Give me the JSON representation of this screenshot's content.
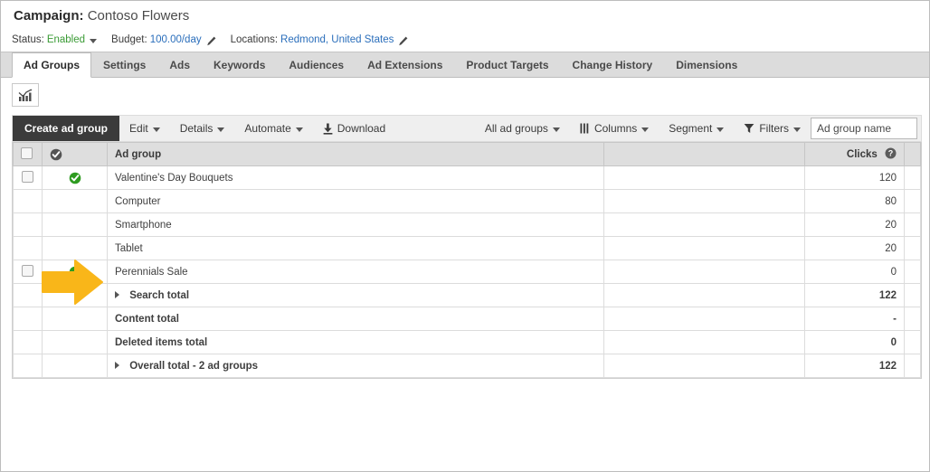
{
  "campaign": {
    "label": "Campaign:",
    "name": "Contoso Flowers"
  },
  "meta": {
    "status_key": "Status:",
    "status_value": "Enabled",
    "budget_key": "Budget:",
    "budget_value": "100.00/day",
    "locations_key": "Locations:",
    "locations_value": "Redmond, United States"
  },
  "tabs": [
    {
      "label": "Ad Groups",
      "active": true
    },
    {
      "label": "Settings",
      "active": false
    },
    {
      "label": "Ads",
      "active": false
    },
    {
      "label": "Keywords",
      "active": false
    },
    {
      "label": "Audiences",
      "active": false
    },
    {
      "label": "Ad Extensions",
      "active": false
    },
    {
      "label": "Product Targets",
      "active": false
    },
    {
      "label": "Change History",
      "active": false
    },
    {
      "label": "Dimensions",
      "active": false
    }
  ],
  "chart_toggle": {
    "icon": "bar-chart-icon"
  },
  "toolbar": {
    "create_label": "Create ad group",
    "edit_label": "Edit",
    "details_label": "Details",
    "automate_label": "Automate",
    "download_label": "Download",
    "download_icon": "download-icon",
    "all_ad_groups_label": "All ad groups",
    "columns_label": "Columns",
    "columns_icon": "columns-icon",
    "segment_label": "Segment",
    "filters_label": "Filters",
    "filters_icon": "funnel-icon",
    "search_placeholder": "Ad group name",
    "search_value": ""
  },
  "table": {
    "headers": {
      "checkbox": "",
      "status": "status-check-icon",
      "name": "Ad group",
      "mid": "",
      "clicks": "Clicks",
      "clicks_help_icon": "help-icon"
    },
    "rows": [
      {
        "type": "adgroup",
        "checkbox": true,
        "status": "enabled",
        "name": "Valentine's Day Bouquets",
        "indent": 0,
        "link": true,
        "clicks": "120"
      },
      {
        "type": "segment",
        "checkbox": false,
        "status": "none",
        "name": "Computer",
        "indent": 1,
        "link": false,
        "clicks": "80"
      },
      {
        "type": "segment",
        "checkbox": false,
        "status": "none",
        "name": "Smartphone",
        "indent": 1,
        "link": false,
        "clicks": "20"
      },
      {
        "type": "segment",
        "checkbox": false,
        "status": "none",
        "name": "Tablet",
        "indent": 1,
        "link": false,
        "clicks": "20"
      },
      {
        "type": "adgroup",
        "checkbox": true,
        "status": "enabled",
        "name": "Perennials Sale",
        "indent": 0,
        "link": true,
        "clicks": "0"
      },
      {
        "type": "total",
        "checkbox": false,
        "status": "none",
        "name": "Search total",
        "indent": 0,
        "link": false,
        "expander": true,
        "clicks": "122"
      },
      {
        "type": "total",
        "checkbox": false,
        "status": "none",
        "name": "Content total",
        "indent": 0,
        "link": false,
        "expander": false,
        "clicks": "-"
      },
      {
        "type": "total",
        "checkbox": false,
        "status": "none",
        "name": "Deleted items total",
        "indent": 0,
        "link": false,
        "expander": false,
        "clicks": "0"
      },
      {
        "type": "total",
        "checkbox": false,
        "status": "none",
        "name": "Overall total - 2 ad groups",
        "indent": 0,
        "link": false,
        "expander": true,
        "clicks": "122"
      }
    ]
  },
  "annotation": {
    "arrow_icon": "arrow-right-annotation",
    "color": "#f9b619"
  },
  "colors": {
    "accent_blue": "#2a6ebb",
    "status_green": "#3a9b35",
    "primary_button": "#3b3b3b",
    "toolbar_bg": "#efefef",
    "tab_bg": "#dcdcdc",
    "header_bg": "#dedede",
    "annotation_orange": "#f9b619"
  }
}
